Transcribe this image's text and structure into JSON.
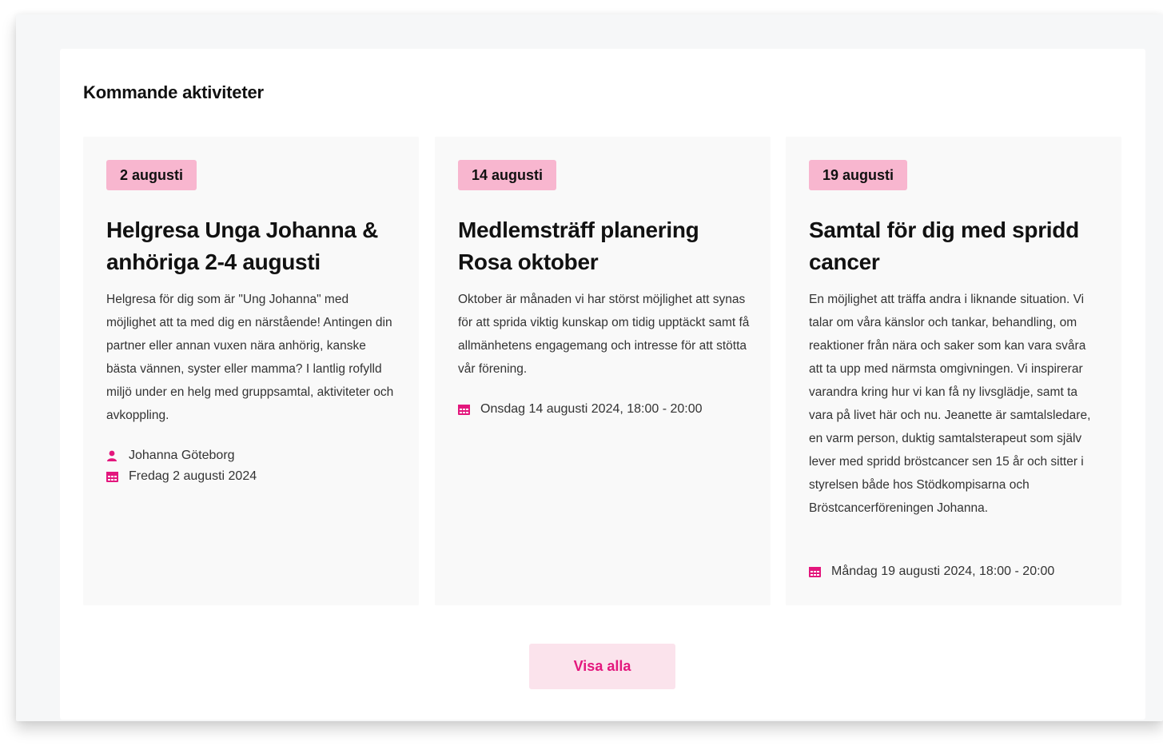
{
  "section": {
    "title": "Kommande aktiviteter"
  },
  "accent_color": "#e3177d",
  "badge_color": "#f8b6cf",
  "cards": [
    {
      "date": "2 augusti",
      "title": "Helgresa Unga Johanna & anhöriga 2-4 augusti",
      "description": "Helgresa för dig som är \"Ung Johanna\" med möjlighet att ta med dig en närstående! Antingen din partner eller annan vuxen nära anhörig, kanske bästa vännen, syster eller mamma? I lantlig rofylld miljö under en helg med gruppsamtal, aktiviteter och avkoppling.",
      "organizer": "Johanna Göteborg",
      "when": "Fredag 2 augusti 2024"
    },
    {
      "date": "14 augusti",
      "title": "Medlemsträff planering Rosa oktober",
      "description": "Oktober är månaden vi har störst möjlighet att synas för att sprida viktig kunskap om tidig upptäckt samt få allmänhetens engagemang och intresse för att stötta vår förening.",
      "when": "Onsdag 14 augusti 2024, 18:00 - 20:00"
    },
    {
      "date": "19 augusti",
      "title": "Samtal för dig med spridd cancer",
      "description": "En möjlighet att träffa andra i liknande situation. Vi talar om våra känslor och tankar, behandling, om reaktioner från nära och saker som kan vara svåra att ta upp med närmsta omgivningen. Vi inspirerar varandra kring hur vi kan få ny livsglädje, samt ta vara på livet här och nu. Jeanette är samtalsledare, en varm person, duktig samtalsterapeut som själv lever med spridd bröstcancer sen 15 år och sitter i styrelsen både hos Stödkompisarna och Bröstcancerföreningen Johanna.",
      "when": "Måndag 19 augusti 2024, 18:00 - 20:00"
    }
  ],
  "actions": {
    "show_all_label": "Visa alla"
  }
}
